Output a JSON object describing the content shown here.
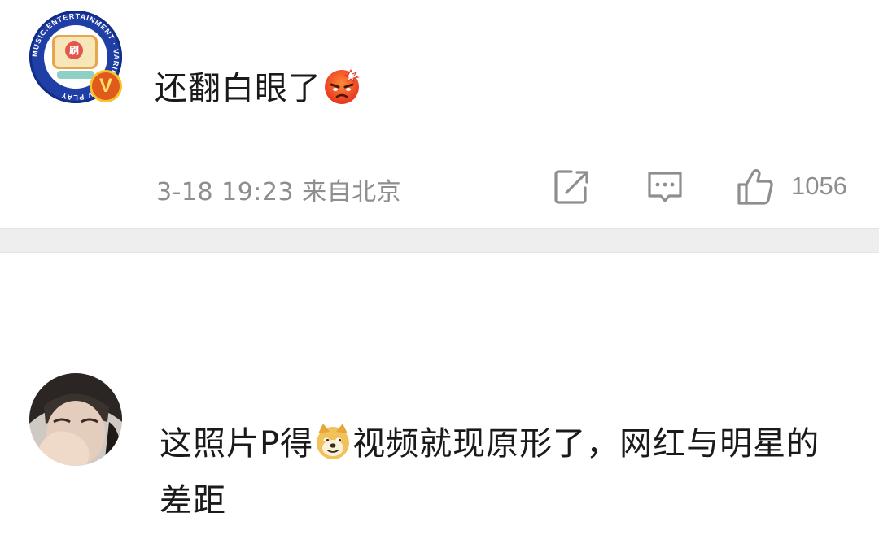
{
  "comments": [
    {
      "avatar_text": "MUSIC.ENTERTAINMENT · VARIETY · TV PLAY",
      "avatar_mark": "刷",
      "badge": "V",
      "text": "还翻白眼了",
      "emoji": "angry-face-emoji",
      "timestamp": "3-18 19:23 来自北京",
      "likes": "1056"
    },
    {
      "text": "这照片P得",
      "emoji": "doge-emoji",
      "text_after": "视频就现原形了，网红与明星的差距"
    }
  ],
  "colors": {
    "text": "#1a1a1a",
    "meta": "#8e8e8e",
    "divider": "#eeeeee",
    "badge": "#e05a1e"
  },
  "icons": [
    "share-icon",
    "comment-icon",
    "like-icon"
  ]
}
